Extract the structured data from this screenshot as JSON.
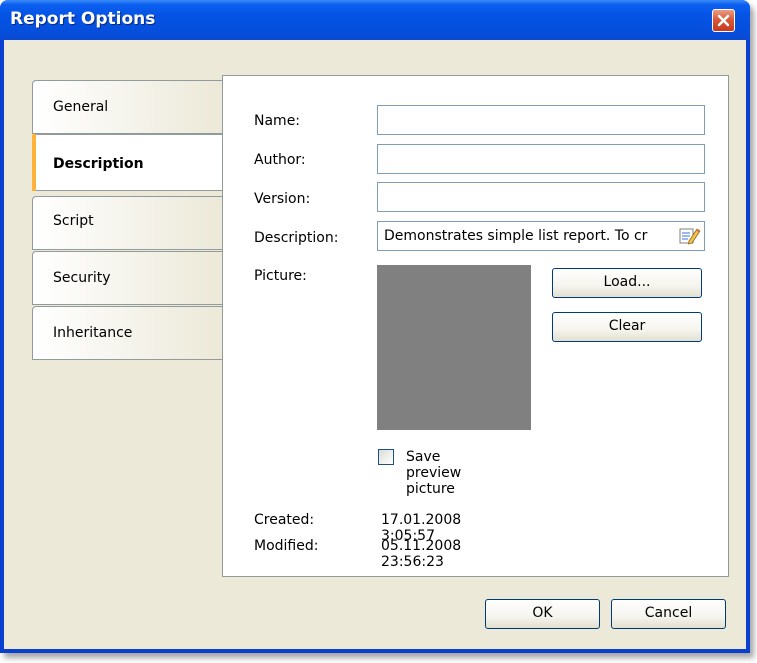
{
  "window": {
    "title": "Report Options"
  },
  "tabs": [
    {
      "label": "General",
      "active": false
    },
    {
      "label": "Description",
      "active": true
    },
    {
      "label": "Script",
      "active": false
    },
    {
      "label": "Security",
      "active": false
    },
    {
      "label": "Inheritance",
      "active": false
    }
  ],
  "form": {
    "name_label": "Name:",
    "name_value": "",
    "author_label": "Author:",
    "author_value": "",
    "version_label": "Version:",
    "version_value": "",
    "description_label": "Description:",
    "description_value": "Demonstrates simple list report. To cr",
    "picture_label": "Picture:",
    "load_button": "Load...",
    "clear_button": "Clear",
    "save_preview_label": "Save preview picture",
    "save_preview_checked": false,
    "created_label": "Created:",
    "created_value": "17.01.2008 3:05:57",
    "modified_label": "Modified:",
    "modified_value": "05.11.2008 23:56:23"
  },
  "footer": {
    "ok_button": "OK",
    "cancel_button": "Cancel"
  },
  "icons": {
    "close": "close-icon",
    "edit_description": "edit-pencil-icon"
  },
  "colors": {
    "titlebar": "#0553e4",
    "dialog_bg": "#ece9d8",
    "active_tab_accent": "#ffb23a",
    "picture_placeholder": "#808080",
    "close_button": "#d85a3c"
  }
}
